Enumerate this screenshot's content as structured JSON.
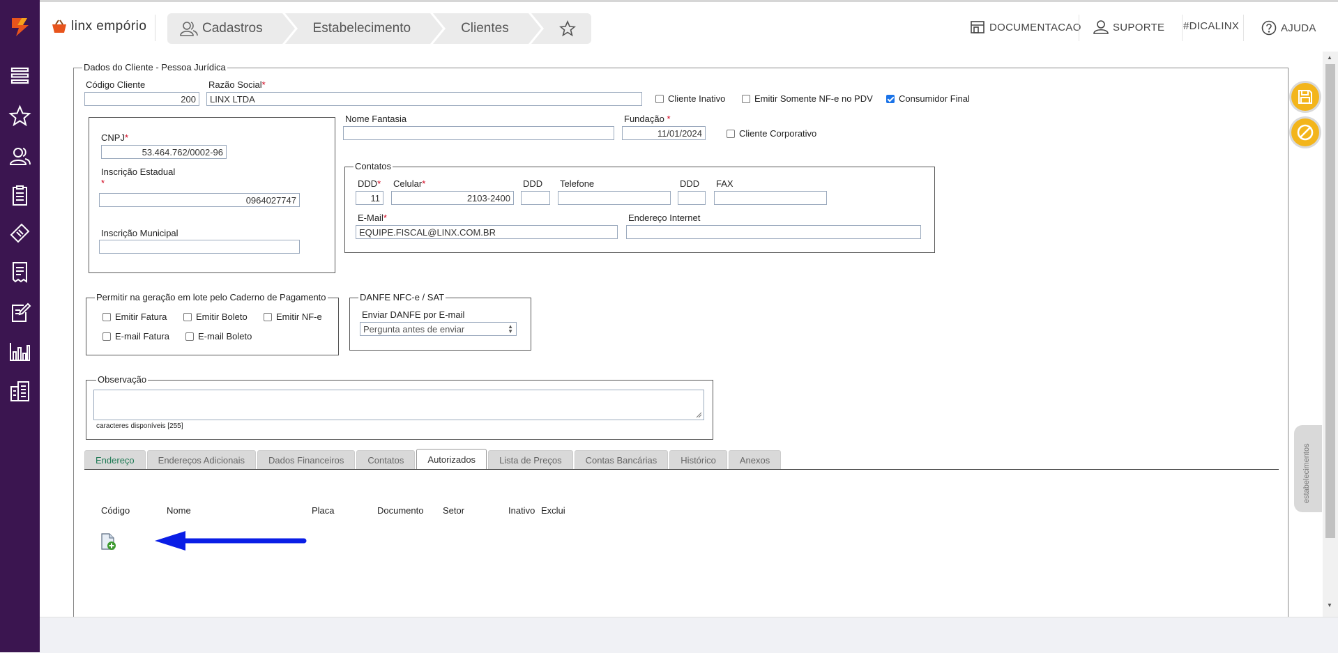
{
  "header": {
    "brand": "linx empório",
    "breadcrumbs": [
      "Cadastros",
      "Estabelecimento",
      "Clientes"
    ],
    "links": {
      "documentacao": "DOCUMENTACAO",
      "suporte": "SUPORTE",
      "dicalinx": "#DICALINX",
      "ajuda": "AJUDA"
    }
  },
  "sidebar": {
    "icons": [
      "menu-icon",
      "star-icon",
      "users-icon",
      "clipboard-icon",
      "ticket-icon",
      "receipt-icon",
      "edit-document-icon",
      "chart-icon",
      "building-icon"
    ]
  },
  "form": {
    "section_title": "Dados do Cliente - Pessoa Jurídica",
    "codigo_cliente": {
      "label": "Código Cliente",
      "value": "200"
    },
    "razao_social": {
      "label": "Razão Social",
      "value": "LINX LTDA"
    },
    "cliente_inativo": {
      "label": "Cliente Inativo",
      "checked": false
    },
    "emitir_somente_nfe": {
      "label": "Emitir Somente NF-e no PDV",
      "checked": false
    },
    "consumidor_final": {
      "label": "Consumidor Final",
      "checked": true
    },
    "cnpj": {
      "label": "CNPJ",
      "value": "53.464.762/0002-96"
    },
    "inscricao_estadual": {
      "label": "Inscrição Estadual",
      "value": "0964027747"
    },
    "inscricao_municipal": {
      "label": "Inscrição Municipal",
      "value": ""
    },
    "nome_fantasia": {
      "label": "Nome Fantasia",
      "value": ""
    },
    "fundacao": {
      "label": "Fundação",
      "value": "11/01/2024"
    },
    "cliente_corporativo": {
      "label": "Cliente Corporativo",
      "checked": false
    },
    "contatos": {
      "title": "Contatos",
      "ddd_label": "DDD",
      "ddd_value": "11",
      "celular_label": "Celular",
      "celular_value": "2103-2400",
      "ddd2_label": "DDD",
      "telefone_label": "Telefone",
      "ddd3_label": "DDD",
      "fax_label": "FAX",
      "email_label": "E-Mail",
      "email_value": "EQUIPE.FISCAL@LINX.COM.BR",
      "endereco_internet_label": "Endereço Internet"
    },
    "caderno": {
      "title": "Permitir na geração em lote pelo Caderno de Pagamento",
      "emitir_fatura": "Emitir Fatura",
      "emitir_boleto": "Emitir Boleto",
      "emitir_nfe": "Emitir NF-e",
      "email_fatura": "E-mail Fatura",
      "email_boleto": "E-mail Boleto"
    },
    "danfe": {
      "title": "DANFE NFC-e / SAT",
      "enviar_label": "Enviar DANFE por E-mail",
      "selected": "Pergunta antes de enviar"
    },
    "observacao": {
      "title": "Observação",
      "counter": "caracteres disponíveis [255]"
    }
  },
  "tabs": [
    "Endereço",
    "Endereços Adicionais",
    "Dados Financeiros",
    "Contatos",
    "Autorizados",
    "Lista de Preços",
    "Contas Bancárias",
    "Histórico",
    "Anexos"
  ],
  "active_tab": "Autorizados",
  "autorizados": {
    "columns": [
      "Código",
      "Nome",
      "Placa",
      "Documento",
      "Setor",
      "Inativo",
      "Exclui"
    ]
  },
  "side_panel": {
    "label": "estabelecimentos"
  },
  "colors": {
    "sidebar": "#3b1550",
    "accent": "#f3b51b",
    "arrow": "#0a1ee6",
    "brand_orange": "#e8541c"
  }
}
